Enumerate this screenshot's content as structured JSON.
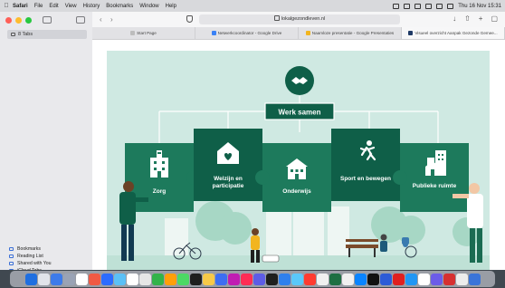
{
  "menubar": {
    "app_name": "Safari",
    "items": [
      "File",
      "Edit",
      "View",
      "History",
      "Bookmarks",
      "Window",
      "Help"
    ],
    "clock": "Thu 16 Nov 15:31"
  },
  "sidebar": {
    "tabs_label": "8 Tabs",
    "links": [
      "Bookmarks",
      "Reading List",
      "Shared with You",
      "iCloud Tabs"
    ]
  },
  "toolbar": {
    "url": "lokalgezondleven.nl"
  },
  "tabs": [
    {
      "label": "Start Page",
      "color": "#bdbdbd"
    },
    {
      "label": "Netwerkcoordinator - Google Drive",
      "color": "#3b82f6"
    },
    {
      "label": "Naamloze presentatie - Google Presentaties",
      "color": "#f2b51f"
    },
    {
      "label": "Visueel overzicht Aanpak Gezonde Gemee...",
      "color": "#1f3a66"
    }
  ],
  "illustration": {
    "heading": "Werk samen",
    "pieces": [
      {
        "label": "Zorg",
        "icon": "hospital-icon"
      },
      {
        "label": "Welzijn en participatie",
        "icon": "heart-house-icon"
      },
      {
        "label": "Onderwijs",
        "icon": "school-icon"
      },
      {
        "label": "Sport en bewegen",
        "icon": "runner-icon"
      },
      {
        "label": "Publieke ruimte",
        "icon": "city-icon"
      }
    ],
    "colors": {
      "background": "#cfe9e2",
      "primary": "#0f5f48",
      "white": "#ffffff"
    }
  },
  "dock": {
    "apps": [
      "#1f6fe0",
      "#e1e4ea",
      "#3d7bea",
      "#9aa3b5",
      "#ffffff",
      "#f05a44",
      "#2b6cff",
      "#5bc0f6",
      "#ffffff",
      "#e6e6e6",
      "#32b34a",
      "#ff9f0a",
      "#4cd964",
      "#1f1f1f",
      "#f7c948",
      "#3d6ef2",
      "#c01db2",
      "#ff2d55",
      "#5e5ce6",
      "#1f1f1f",
      "#2f80ed",
      "#5ac8fa",
      "#ff3b30",
      "#f0f0f0",
      "#1d6f42",
      "#f0f0f0",
      "#0a84ff",
      "#111111",
      "#2d5bd7",
      "#e02020",
      "#2196f3",
      "#ffffff",
      "#6c5ce7",
      "#d63031",
      "#ececec",
      "#3a74d9"
    ]
  }
}
